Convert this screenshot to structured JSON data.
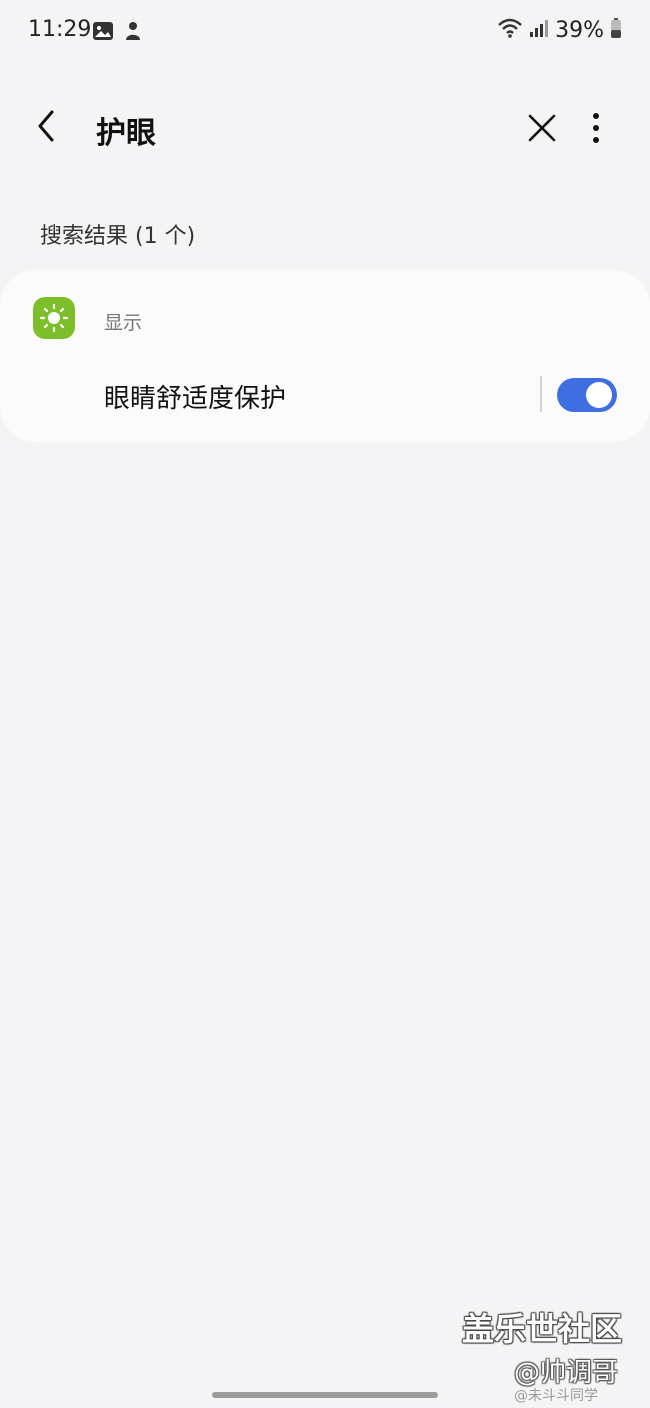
{
  "status_bar": {
    "time": "11:29",
    "battery_percent": "39%",
    "left_icons": [
      "gallery-icon",
      "notification-icon"
    ],
    "right_icons": [
      "wifi-icon",
      "signal-icon",
      "battery-icon"
    ]
  },
  "app_bar": {
    "title": "护眼",
    "back_icon": "chevron-left-icon",
    "close_icon": "close-icon",
    "more_icon": "more-vertical-icon"
  },
  "results": {
    "header": "搜索结果 (1 个)",
    "items": [
      {
        "category": "显示",
        "category_icon": "sun-icon",
        "category_color": "#7dbf2a",
        "setting": "眼睛舒适度保护",
        "toggle_on": true,
        "toggle_color": "#3f6ee3"
      }
    ]
  },
  "watermark": {
    "line1": "盖乐世社区",
    "line2": "@帅调哥",
    "line3": "@未斗斗同学"
  }
}
